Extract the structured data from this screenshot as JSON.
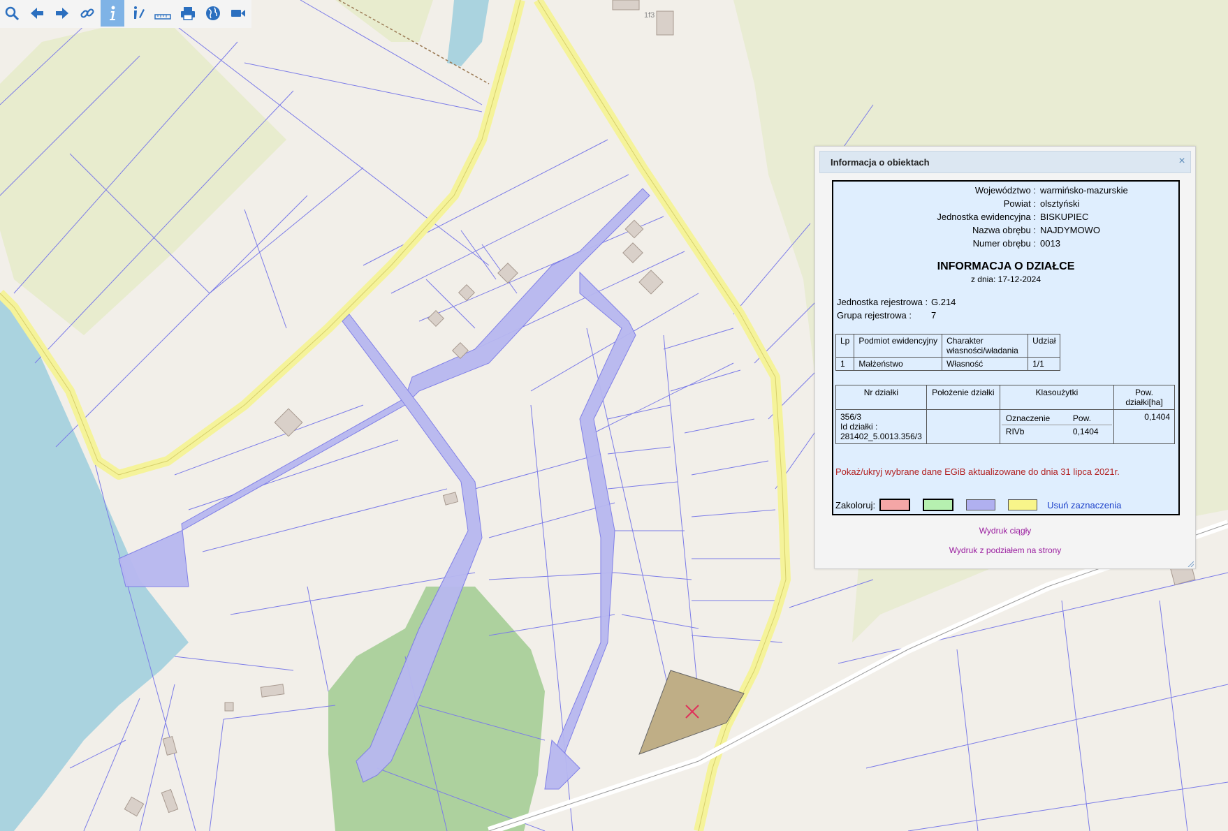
{
  "toolbar": {
    "buttons": [
      {
        "icon": "zoom-icon"
      },
      {
        "icon": "back-arrow-icon"
      },
      {
        "icon": "forward-arrow-icon"
      },
      {
        "icon": "link-icon"
      },
      {
        "icon": "info-icon",
        "active": true
      },
      {
        "icon": "info-edit-icon"
      },
      {
        "icon": "measure-ruler-icon"
      },
      {
        "icon": "print-icon"
      },
      {
        "icon": "globe-icon"
      },
      {
        "icon": "video-camera-icon"
      }
    ]
  },
  "map": {
    "house_label": "1f3",
    "marker_icon": "parcel-marker-x-icon"
  },
  "dialog": {
    "title": "Informacja o obiektach",
    "header": {
      "wojewodztwo_label": "Województwo :",
      "wojewodztwo": "warmińsko-mazurskie",
      "powiat_label": "Powiat :",
      "powiat": "olsztyński",
      "jednostka_label": "Jednostka ewidencyjna :",
      "jednostka": "BISKUPIEC",
      "obreb_label": "Nazwa obrębu :",
      "obreb": "NAJDYMOWO",
      "numer_label": "Numer obrębu :",
      "numer": "0013"
    },
    "info_title": "INFORMACJA O DZIAŁCE",
    "info_date": "z dnia: 17-12-2024",
    "registry": {
      "jedn_label": "Jednostka rejestrowa :",
      "jedn": "G.214",
      "grupa_label": "Grupa rejestrowa :",
      "grupa": "7"
    },
    "owner_table": {
      "headers": [
        "Lp",
        "Podmiot ewidencyjny",
        "Charakter własności/władania",
        "Udział"
      ],
      "rows": [
        [
          "1",
          "Małżeństwo",
          "Własność",
          "1/1"
        ]
      ]
    },
    "parcel_table": {
      "headers": [
        "Nr działki",
        "Położenie działki",
        "Klasoużytki",
        "Pow. działki[ha]"
      ],
      "nr": "356/3",
      "id_label": "Id działki :",
      "id": "281402_5.0013.356/3",
      "polozenie": "",
      "klas_headers": [
        "Oznaczenie",
        "Pow."
      ],
      "klas_rows": [
        [
          "RIVb",
          "0,1404"
        ]
      ],
      "pow": "0,1404"
    },
    "egib_link": "Pokaż/ukryj wybrane dane EGiB aktualizowane do dnia 31 lipca 2021r.",
    "colorize_label": "Zakoloruj:",
    "colors": [
      "#f4a6a6",
      "#b6f0b0",
      "#b0b0f0",
      "#f8f58a"
    ],
    "clear_label": "Usuń zaznaczenia",
    "print_continuous": "Wydruk ciągły",
    "print_paged": "Wydruk z podziałem na strony"
  }
}
